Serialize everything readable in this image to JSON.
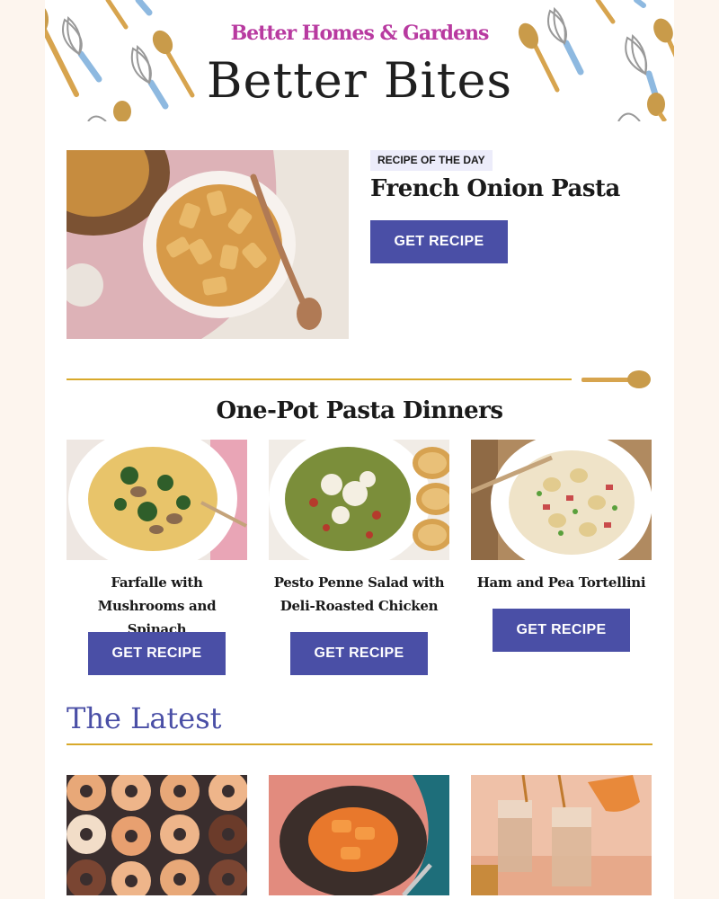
{
  "header": {
    "brand": "Better Homes & Gardens",
    "title": "Better Bites",
    "decor_icons": [
      "whisk-icon",
      "wooden-spoon-icon"
    ]
  },
  "featured": {
    "badge": "RECIPE OF THE DAY",
    "title": "French Onion Pasta",
    "button_label": "GET RECIPE",
    "image": "french-onion-pasta-photo"
  },
  "section": {
    "title": "One-Pot Pasta Dinners",
    "recipes": [
      {
        "title": "Farfalle with Mushrooms and Spinach",
        "button_label": "GET RECIPE"
      },
      {
        "title": "Pesto Penne Salad with Deli-Roasted Chicken",
        "button_label": "GET RECIPE"
      },
      {
        "title": "Ham and Pea Tortellini",
        "button_label": "GET RECIPE"
      }
    ]
  },
  "latest": {
    "title": "The Latest",
    "images": [
      "donuts-photo",
      "pasta-plate-photo",
      "iced-coffee-photo"
    ]
  },
  "colors": {
    "accent": "#4a4fa6",
    "brand": "#b83aa0",
    "divider": "#d8a92a",
    "background": "#fdf5ee"
  }
}
